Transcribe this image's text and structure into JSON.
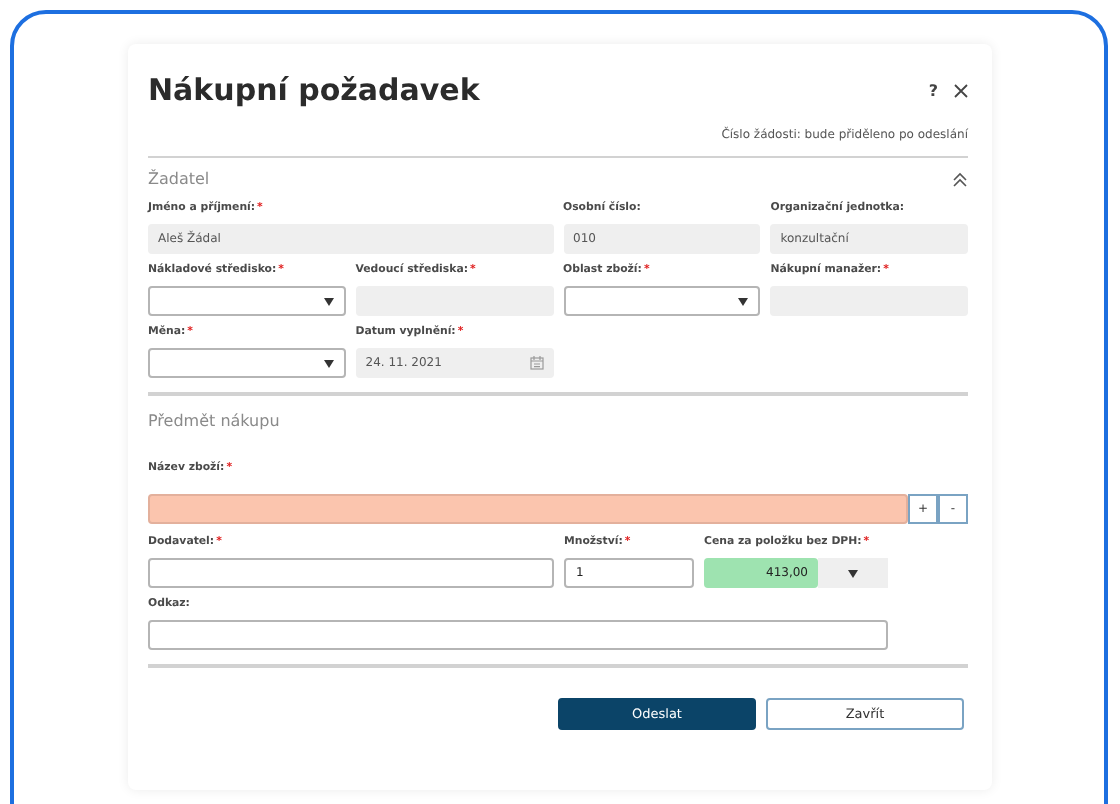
{
  "dialog": {
    "title": "Nákupní požadavek",
    "help": "?",
    "request_number": "Číslo žádosti: bude přiděleno po odeslání"
  },
  "requester": {
    "title": "Žadatel",
    "expanded": true,
    "rows": [
      [
        {
          "label": "Jméno a příjmení:",
          "mark": "*",
          "kind": "readonly",
          "value": "Aleš Žádal"
        },
        {
          "kind": "continued"
        },
        {
          "label": "Osobní číslo:",
          "kind": "readonly",
          "value": "010"
        },
        {
          "label": "Organizační jednotka:",
          "kind": "readonly",
          "value": "konzultační"
        }
      ],
      [
        {
          "label": "Nákladové středisko:",
          "mark": "*",
          "kind": "select"
        },
        {
          "label": "Vedoucí střediska:",
          "mark": "*",
          "kind": "readonly"
        },
        {
          "label": "Oblast zboží:",
          "mark": "*",
          "kind": "select"
        },
        {
          "label": "Nákupní manažer:",
          "mark": "*",
          "kind": "readonly"
        }
      ],
      [
        {
          "label": "Měna:",
          "mark": "*",
          "kind": "select"
        },
        {
          "label": "Datum vyplnění:",
          "mark": "*",
          "kind": "date",
          "value": "24. 11. 2021"
        }
      ]
    ]
  },
  "purchase": {
    "title": "Předmět nákupu",
    "item_name": {
      "label": "Název zboží:",
      "mark": "*",
      "invalid": true,
      "add": "+",
      "remove": "-"
    },
    "supplier": {
      "label": "Dodavatel:",
      "mark": "*"
    },
    "quantity": {
      "label": "Množství:",
      "mark": "*",
      "value": "1"
    },
    "price": {
      "label": "Cena za položku bez DPH:",
      "mark": "*",
      "value": "413,00",
      "valid": true
    },
    "link": {
      "label": "Odkaz:"
    }
  },
  "buttons": [
    {
      "label": "Odeslat",
      "kind": "primary"
    },
    {
      "label": "Zavřít",
      "kind": "secondary"
    }
  ]
}
